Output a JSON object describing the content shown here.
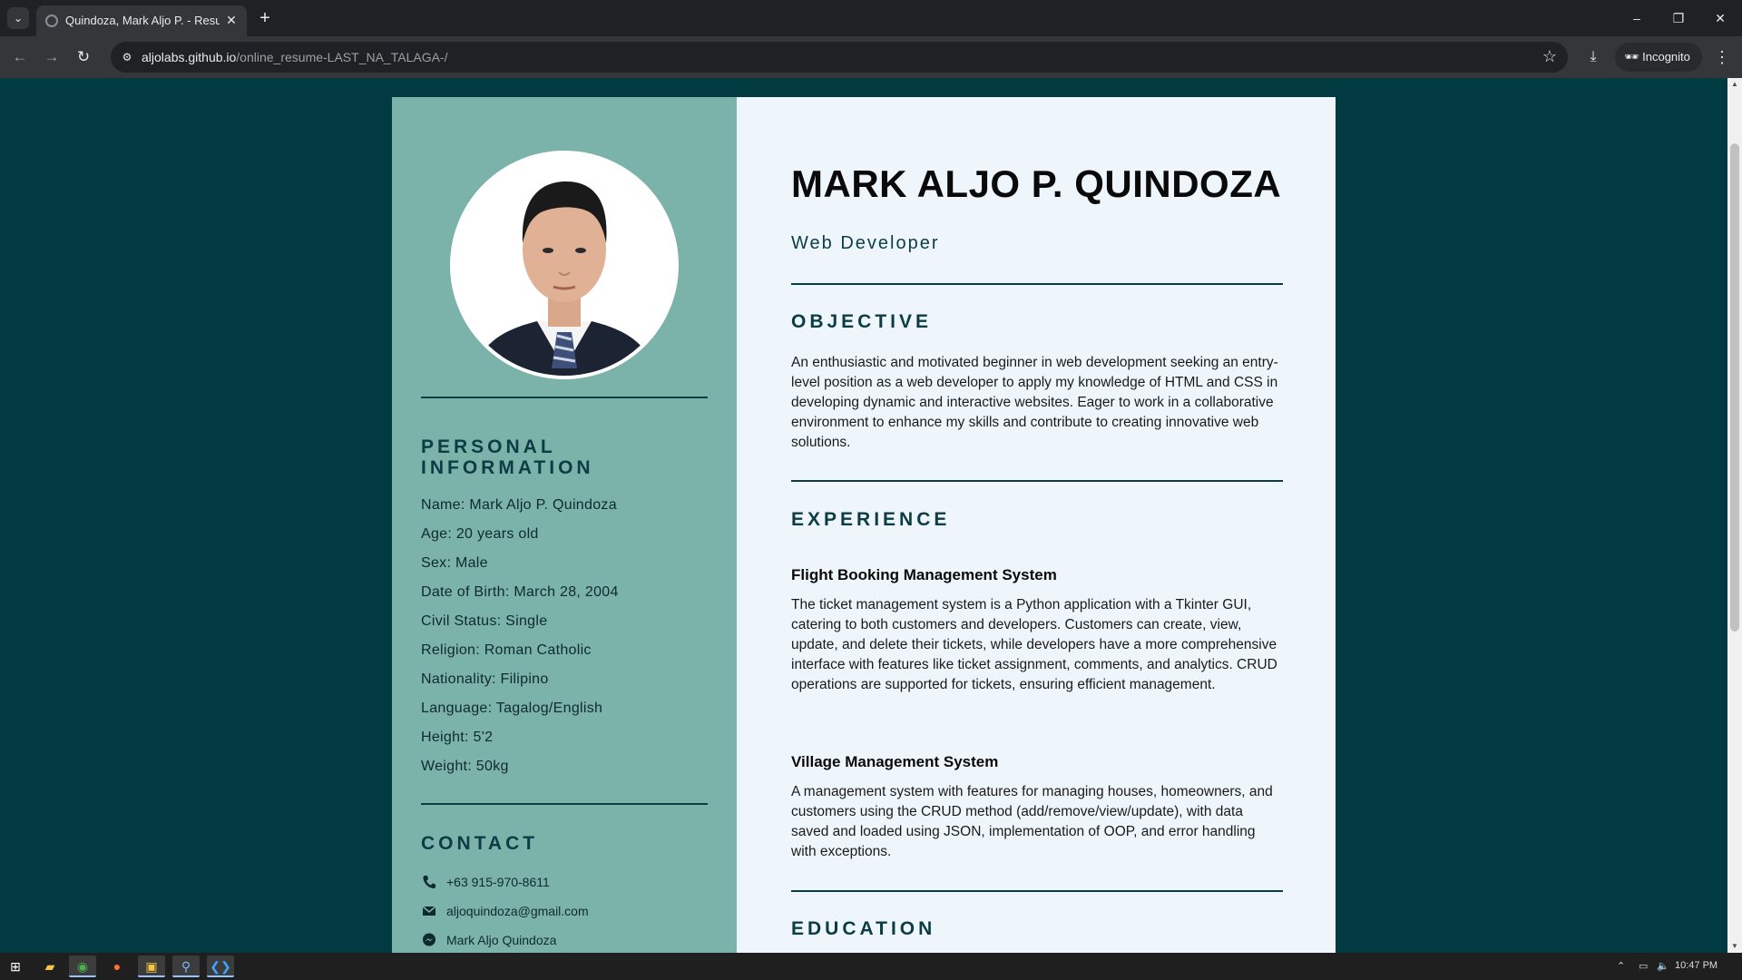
{
  "browser": {
    "tab_title": "Quindoza, Mark Aljo P. - Resume",
    "url_host": "aljolabs.github.io",
    "url_path": "/online_resume-LAST_NA_TALAGA-/",
    "incognito_label": "Incognito"
  },
  "resume": {
    "name": "MARK ALJO P. QUINDOZA",
    "role": "Web Developer",
    "personal_heading": "PERSONAL INFORMATION",
    "personal": [
      "Name: Mark Aljo P. Quindoza",
      "Age: 20 years old",
      "Sex: Male",
      "Date of Birth: March 28, 2004",
      "Civil Status: Single",
      "Religion: Roman Catholic",
      "Nationality: Filipino",
      "Language: Tagalog/English",
      "Height: 5'2",
      "Weight: 50kg"
    ],
    "contact_heading": "CONTACT",
    "contact": {
      "phone": "+63 915-970-8611",
      "email": "aljoquindoza@gmail.com",
      "messenger": "Mark Aljo Quindoza"
    },
    "objective_heading": "OBJECTIVE",
    "objective": "An enthusiastic and motivated beginner in web development seeking an entry-level position as a web developer to apply my knowledge of HTML and CSS in developing dynamic and interactive websites. Eager to work in a collaborative environment to enhance my skills and contribute to creating innovative web solutions.",
    "experience_heading": "EXPERIENCE",
    "experience": [
      {
        "title": "Flight Booking Management System",
        "description": "The ticket management system is a Python application with a Tkinter GUI, catering to both customers and developers. Customers can create, view, update, and delete their tickets, while developers have a more comprehensive interface with features like ticket assignment, comments, and analytics. CRUD operations are supported for tickets, ensuring efficient management."
      },
      {
        "title": "Village Management System",
        "description": "A management system with features for managing houses, homeowners, and customers using the CRUD method (add/remove/view/update), with data saved and loaded using JSON, implementation of OOP, and error handling with exceptions."
      }
    ],
    "education_heading": "EDUCATION"
  },
  "taskbar": {
    "clock": "10:47 PM"
  },
  "colors": {
    "page_bg": "#013a40",
    "sidebar_bg": "#7bb2aa",
    "main_bg": "#eef6fc",
    "accent": "#0c3c44"
  }
}
